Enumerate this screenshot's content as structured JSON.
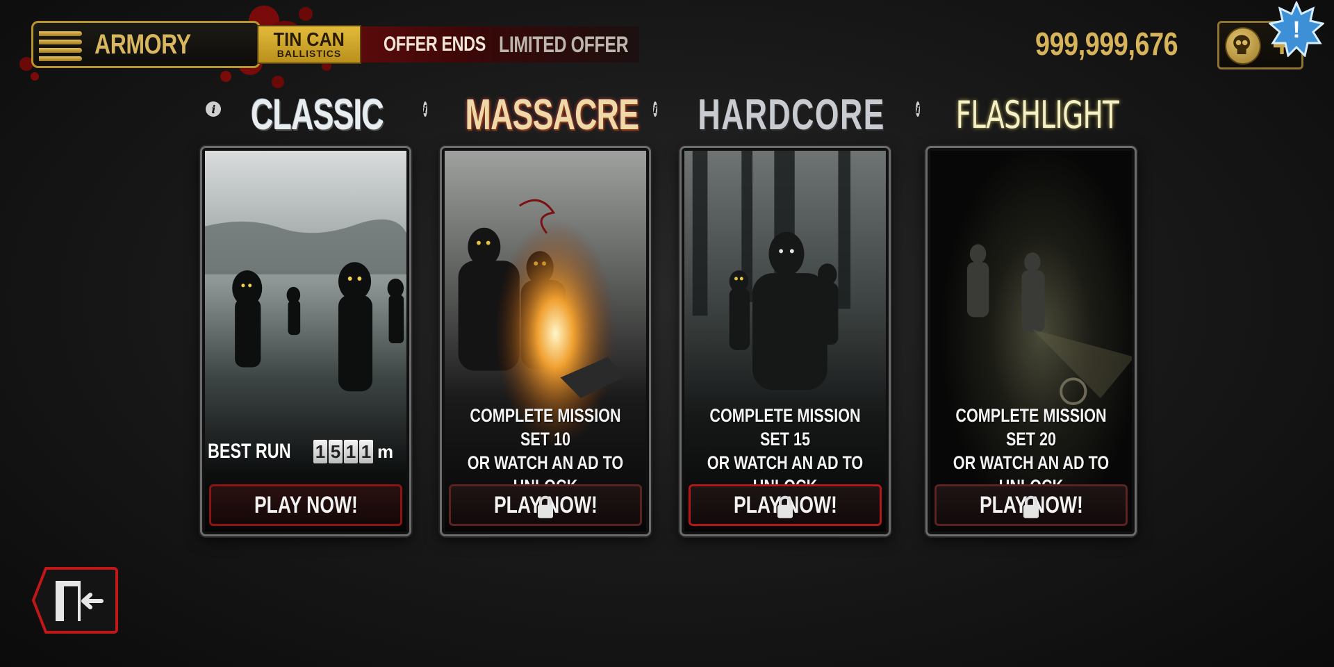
{
  "header": {
    "armory_label": "ARMORY",
    "sponsor_line1": "TIN CAN",
    "sponsor_line2": "BALLISTICS",
    "offer_ends_label": "OFFER ENDS",
    "limited_offer_label": "LIMITED OFFER",
    "currency_amount": "999,999,676",
    "add_currency_label": "+",
    "alert_badge_label": "!"
  },
  "modes": [
    {
      "title": "CLASSIC",
      "info_label": "i",
      "best_run_label": "BEST RUN",
      "best_run_digits": [
        "1",
        "5",
        "1",
        "1"
      ],
      "best_run_unit": "m",
      "play_label": "PLAY NOW!",
      "locked": false
    },
    {
      "title": "MASSACRE",
      "info_label": "i",
      "unlock_text": "COMPLETE MISSION SET 10\nOR WATCH AN AD TO\nUNLOCK",
      "play_label": "PLAY NOW!",
      "locked": true
    },
    {
      "title": "HARDCORE",
      "info_label": "i",
      "unlock_text": "COMPLETE MISSION SET 15\nOR WATCH AN AD TO\nUNLOCK",
      "play_label": "PLAY NOW!",
      "locked": true
    },
    {
      "title": "FLASHLIGHT",
      "info_label": "i",
      "unlock_text": "COMPLETE MISSION SET 20\nOR WATCH AN AD TO\nUNLOCK",
      "play_label": "PLAY NOW!",
      "locked": true
    }
  ],
  "icons": {
    "ammo": "bullets-icon",
    "clock": "clock-icon",
    "coin": "skull-coin-icon",
    "lock": "padlock-icon",
    "exit": "exit-door-icon",
    "info": "info-icon",
    "alert": "alert-burst-icon"
  },
  "colors": {
    "gold": "#d7b45a",
    "blood_red": "#8e1414",
    "offer_red": "#5a0a0a"
  }
}
